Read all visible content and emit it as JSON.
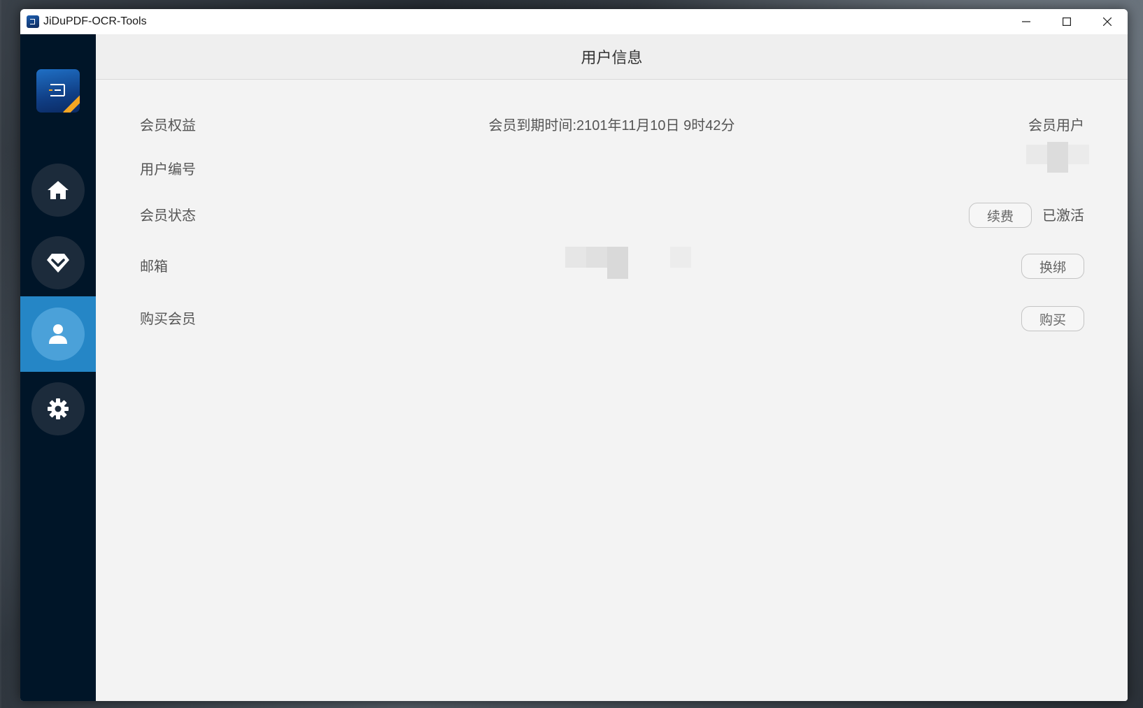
{
  "window": {
    "title": "JiDuPDF-OCR-Tools",
    "controls": {
      "minimize": "—",
      "maximize": "☐",
      "close": "✕"
    }
  },
  "sidebar": {
    "items": [
      {
        "id": "home",
        "icon": "home-icon",
        "active": false
      },
      {
        "id": "vip",
        "icon": "diamond-icon",
        "active": false
      },
      {
        "id": "user",
        "icon": "user-icon",
        "active": true
      },
      {
        "id": "settings",
        "icon": "gear-icon",
        "active": false
      }
    ]
  },
  "page": {
    "title": "用户信息"
  },
  "rows": {
    "benefits": {
      "label": "会员权益",
      "expiry": "会员到期时间:2101年11月10日  9时42分",
      "user_type": "会员用户"
    },
    "user_id": {
      "label": "用户编号"
    },
    "status": {
      "label": "会员状态",
      "renew_button": "续费",
      "value": "已激活"
    },
    "email": {
      "label": "邮箱",
      "rebind_button": "换绑"
    },
    "purchase": {
      "label": "购买会员",
      "buy_button": "购买"
    }
  },
  "colors": {
    "sidebar_bg": "#001528",
    "active_nav": "#2586c6",
    "content_bg": "#f3f3f3"
  }
}
